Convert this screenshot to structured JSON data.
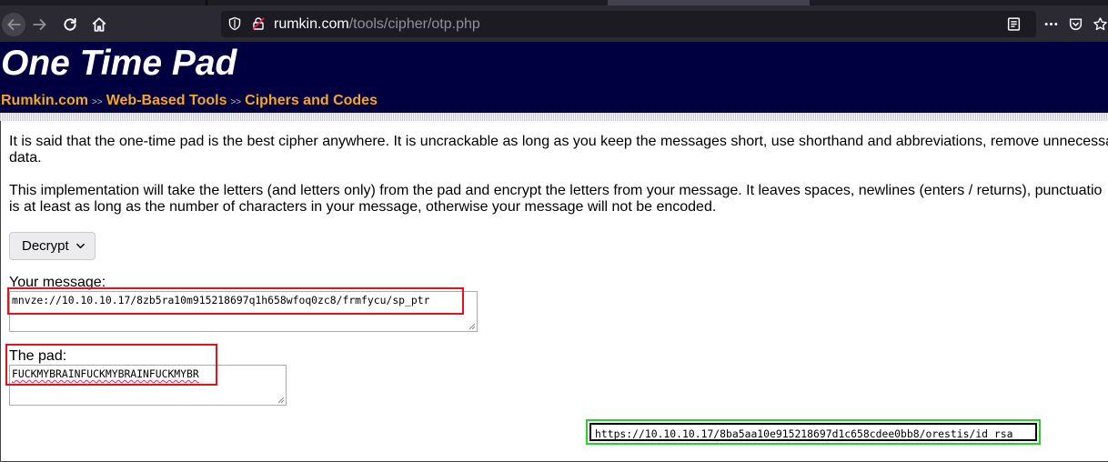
{
  "browser": {
    "url_host": "rumkin.com",
    "url_path": "/tools/cipher/otp.php"
  },
  "site": {
    "title": "One Time Pad",
    "breadcrumbs": [
      {
        "label": "Rumkin.com"
      },
      {
        "label": "Web-Based Tools"
      },
      {
        "label": "Ciphers and Codes"
      }
    ],
    "crumb_separator": ">>"
  },
  "content": {
    "intro_line1": "It is said that the one-time pad is the best cipher anywhere. It is uncrackable as long as you keep the messages short, use shorthand and abbreviations, remove unnecessa",
    "intro_line2": "data.",
    "impl_line1": "This implementation will take the letters (and letters only) from the pad and encrypt the letters from your message. It leaves spaces, newlines (enters / returns), punctuatio",
    "impl_line2": "is at least as long as the number of characters in your message, otherwise your message will not be encoded.",
    "mode_select": "Decrypt",
    "message_label": "Your message:",
    "message_value": "mnvze://10.10.10.17/8zb5ra10m915218697q1h658wfoq0zc8/frmfycu/sp_ptr",
    "pad_label": "The pad:",
    "pad_value": "FUCKMYBRAINFUCKMYBRAINFUCKMYBR",
    "result_value": "https://10.10.10.17/8ba5aa10e915218697d1c658cdee0bb8/orestis/id_rsa"
  },
  "colors": {
    "header_bg": "#000040",
    "link": "#f5a623",
    "highlight_red": "#e8101d",
    "highlight_green": "#22d12a"
  },
  "icons": [
    "back-icon",
    "forward-icon",
    "reload-icon",
    "home-icon",
    "shield-icon",
    "insecure-lock-icon",
    "reader-view-icon",
    "more-icon",
    "pocket-icon",
    "star-icon",
    "chevron-down-icon"
  ]
}
